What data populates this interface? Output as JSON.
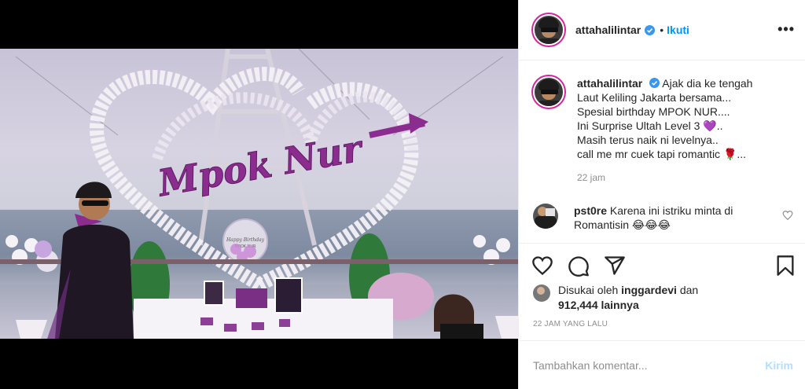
{
  "post": {
    "username": "attahalilintar",
    "follow_label": "Ikuti",
    "dot": "•",
    "more": "•••"
  },
  "caption": {
    "username": "attahalilintar",
    "lines": [
      "Ajak dia ke tengah",
      "Laut Keliling Jakarta bersama...",
      "Spesial birthday MPOK NUR....",
      "Ini Surprise Ultah Level 3 💜..",
      "Masih terus naik ni levelnya..",
      "call me mr cuek tapi romantic 🌹..."
    ],
    "time": "22 jam"
  },
  "comment": {
    "username": "pst0re",
    "text": "Karena ini istriku minta di Romantisin 😂😂😂"
  },
  "likes": {
    "prefix": "Disukai oleh",
    "user": "inggardevi",
    "middle": "dan",
    "count": "912,444 lainnya"
  },
  "date": "22 JAM YANG LALU",
  "add_comment": {
    "placeholder": "Tambahkan komentar...",
    "post_label": "Kirim"
  },
  "media": {
    "sign_text": "Mpok Nur",
    "balloon_text": "Happy Birthday MPOK NUR"
  },
  "colors": {
    "accent": "#0095f6",
    "post_disabled": "#b2dffc",
    "story_ring": "#d6249f",
    "flower_purple": "#8b2d8f"
  }
}
